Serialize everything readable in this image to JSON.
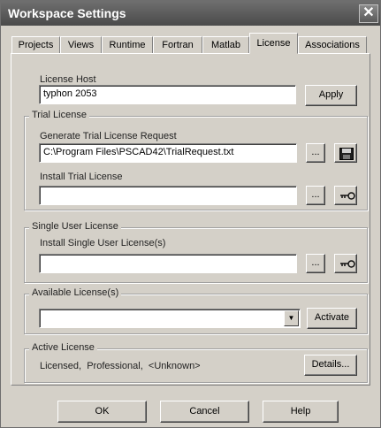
{
  "window": {
    "title": "Workspace Settings",
    "close_symbol": "✕"
  },
  "tabs": [
    {
      "label": "Projects"
    },
    {
      "label": "Views"
    },
    {
      "label": "Runtime"
    },
    {
      "label": "Fortran"
    },
    {
      "label": "Matlab"
    },
    {
      "label": "License"
    },
    {
      "label": "Associations"
    }
  ],
  "active_tab": "License",
  "license_host": {
    "label": "License Host",
    "value": "typhon 2053",
    "apply_label": "Apply"
  },
  "trial_license": {
    "legend": "Trial License",
    "generate_label": "Generate Trial License Request",
    "generate_value": "C:\\Program Files\\PSCAD42\\TrialRequest.txt",
    "install_label": "Install Trial License",
    "install_value": "",
    "browse_label": "..."
  },
  "single_user": {
    "legend": "Single User License",
    "install_label": "Install Single User License(s)",
    "install_value": "",
    "browse_label": "..."
  },
  "available": {
    "legend": "Available License(s)",
    "selected_value": "",
    "activate_label": "Activate"
  },
  "active": {
    "legend": "Active License",
    "status": "Licensed,  Professional,  <Unknown>",
    "details_label": "Details..."
  },
  "footer": {
    "ok_label": "OK",
    "cancel_label": "Cancel",
    "help_label": "Help"
  },
  "icons": {
    "save": "floppy-disk-icon",
    "key": "key-icon",
    "dropdown": "dropdown-arrow-icon"
  }
}
